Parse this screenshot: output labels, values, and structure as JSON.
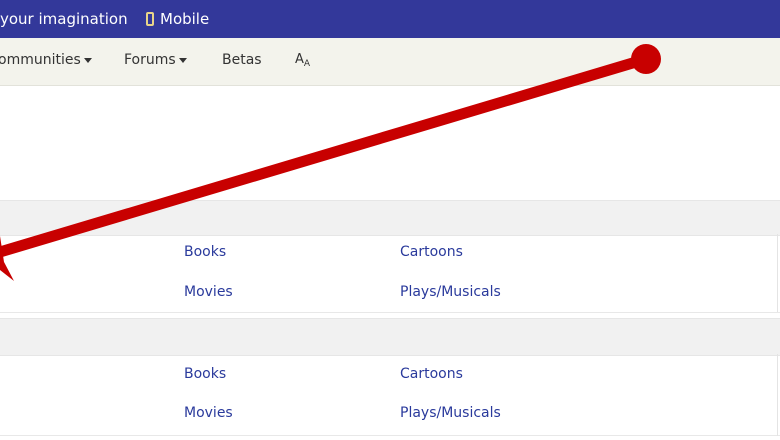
{
  "topbar": {
    "tagline": "your imagination",
    "mobile_label": "Mobile"
  },
  "nav": {
    "communities_label": "ommunities",
    "forums_label": "Forums",
    "betas_label": "Betas",
    "font_big": "A",
    "font_small": "A"
  },
  "section1": {
    "links": {
      "books": "Books",
      "cartoons": "Cartoons",
      "movies": "Movies",
      "plays": "Plays/Musicals"
    }
  },
  "section2": {
    "links": {
      "books": "Books",
      "cartoons": "Cartoons",
      "movies": "Movies",
      "plays": "Plays/Musicals"
    }
  },
  "colors": {
    "topbar_bg": "#33389a",
    "navbar_bg": "#f3f3ec",
    "link": "#2a3a9c",
    "arrow": "#c80000"
  },
  "icons": [
    "phone-icon",
    "caret-down-icon",
    "font-size-icon",
    "red-arrow-annotation"
  ]
}
